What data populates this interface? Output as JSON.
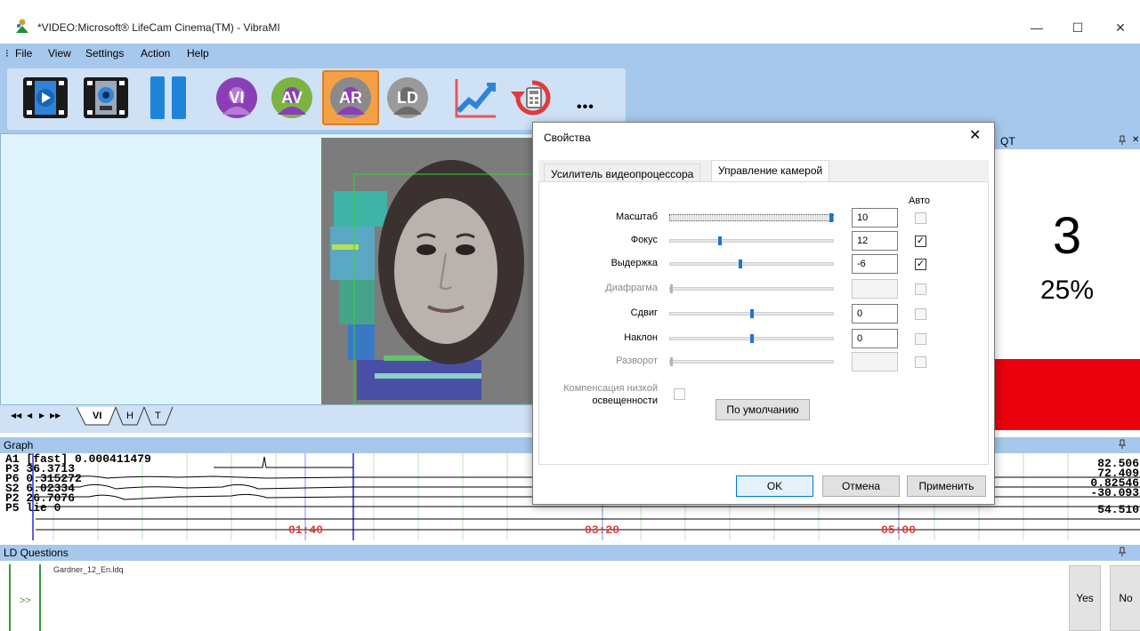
{
  "window": {
    "title": "*VIDEO:Microsoft® LifeCam Cinema(TM) - VibraMI",
    "minimize_glyph": "—",
    "maximize_glyph": "☐",
    "close_glyph": "✕"
  },
  "menu": {
    "grip": "⁝",
    "items": [
      "File",
      "View",
      "Settings",
      "Action",
      "Help"
    ]
  },
  "toolbar": {
    "buttons": [
      {
        "name": "play-video-icon"
      },
      {
        "name": "webcam-icon"
      },
      {
        "name": "pause-icon"
      },
      {
        "name": "vi-button",
        "label": "VI"
      },
      {
        "name": "av-button",
        "label": "AV"
      },
      {
        "name": "ar-button",
        "label": "AR"
      },
      {
        "name": "ld-button",
        "label": "LD"
      },
      {
        "name": "chart-icon"
      },
      {
        "name": "reset-calculator-icon"
      }
    ],
    "more_label": "•••"
  },
  "video_nav": {
    "first": "◀◀",
    "prev": "◀",
    "next": "▶",
    "last": "▶▶",
    "tabs": [
      "VI",
      "H",
      "T"
    ]
  },
  "qt_panel": {
    "title": "QT",
    "pin": "ᵖ",
    "close": "✕",
    "value": "3",
    "percent": "25%"
  },
  "graph": {
    "title": "Graph",
    "left_labels": [
      "A1 [fast] 0.000411479",
      "P3 36.3713",
      "P6 0.315272",
      "S2 6.02334",
      "P2 26.7076",
      "P5 lie 0"
    ],
    "right_values": [
      "82.506",
      "72.409",
      "0.82546",
      "-30.093",
      "54.510"
    ],
    "time_labels": [
      "01:40",
      "03:20",
      "05:00"
    ]
  },
  "ld_questions": {
    "title": "LD Questions",
    "file": "Gardner_12_En.ldq",
    "arrow": ">>",
    "yes": "Yes",
    "no": "No"
  },
  "dialog": {
    "title": "Свойства",
    "close": "✕",
    "tabs": [
      "Усилитель видеопроцессора",
      "Управление камерой"
    ],
    "auto_header": "Авто",
    "rows": [
      {
        "label": "Масштаб",
        "value": "10",
        "level": 1.0,
        "auto": false,
        "enabled": true
      },
      {
        "label": "Фокус",
        "value": "12",
        "level": 0.3,
        "auto": true,
        "enabled": true
      },
      {
        "label": "Выдержка",
        "value": "-6",
        "level": 0.43,
        "auto": true,
        "enabled": true
      },
      {
        "label": "Диафрагма",
        "value": "",
        "level": 0.0,
        "auto": false,
        "enabled": false
      },
      {
        "label": "Сдвиг",
        "value": "0",
        "level": 0.5,
        "auto": false,
        "enabled": true
      },
      {
        "label": "Наклон",
        "value": "0",
        "level": 0.5,
        "auto": false,
        "enabled": true
      },
      {
        "label": "Разворот",
        "value": "",
        "level": 0.0,
        "auto": false,
        "enabled": false
      }
    ],
    "low_light_label_line1": "Компенсация низкой",
    "low_light_label_line2": "освещенности",
    "default_button": "По умолчанию",
    "ok": "OK",
    "cancel": "Отмена",
    "apply": "Применить",
    "check_glyph": "✓"
  },
  "colors": {
    "accent_blue": "#a6c8ec",
    "toolbar_bg": "#cfe1f5",
    "qt_red": "#e8000d",
    "icon_purple": "#8b3fb6",
    "icon_orange": "#f4a044",
    "time_red": "#e03a3a"
  }
}
